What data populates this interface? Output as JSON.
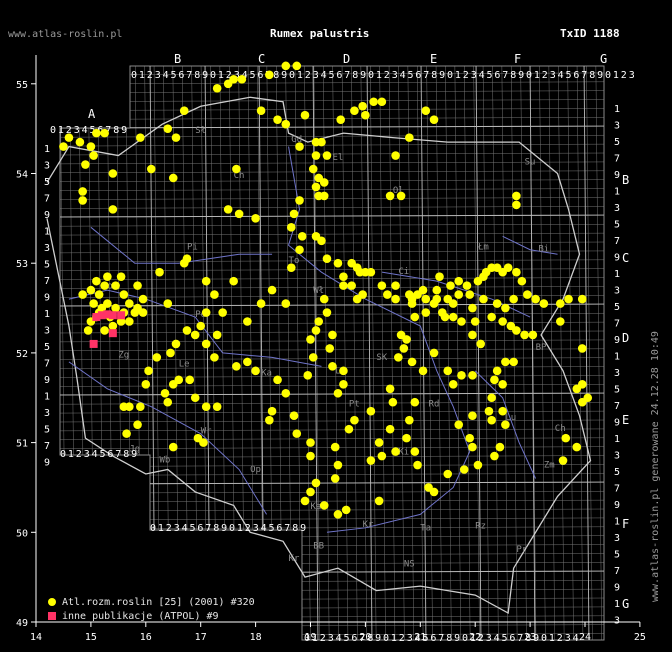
{
  "header": {
    "site": "www.atlas-roslin.pl",
    "title": "Rumex palustris",
    "taxon_id": "TxID 1188"
  },
  "side_note": "www.atlas-roslin.pl generowane 24.12.28 10:49",
  "colors": {
    "background": "#000000",
    "grid": "#8a8a8a",
    "outline": "#cfcfcf",
    "rivers": "#6f74c9",
    "primary_points": "#ffff00",
    "secondary_points": "#ff3366"
  },
  "legend": [
    {
      "symbol": "circle",
      "color": "#ffff00",
      "label": "Atl.rozm.roslin [25] (2001) #320"
    },
    {
      "symbol": "square",
      "color": "#ff3366",
      "label": "inne publikacje (ATPOL) #9"
    }
  ],
  "axes": {
    "x_ticks": [
      14,
      15,
      16,
      17,
      18,
      19,
      20,
      21,
      22,
      23,
      24,
      25
    ],
    "y_ticks": [
      49,
      50,
      51,
      52,
      53,
      54,
      55
    ]
  },
  "grid_letters": {
    "top": [
      "B",
      "C",
      "D",
      "E",
      "F",
      "G"
    ],
    "left_top": "A",
    "right": [
      "B",
      "C",
      "D",
      "E",
      "F",
      "G"
    ]
  },
  "digit_row": "0123456789",
  "cities": [
    {
      "name": "Sł",
      "lon": 16.9,
      "lat": 54.45
    },
    {
      "name": "Gd",
      "lon": 18.65,
      "lat": 54.35
    },
    {
      "name": "El",
      "lon": 19.4,
      "lat": 54.15
    },
    {
      "name": "Ol",
      "lon": 20.5,
      "lat": 53.78
    },
    {
      "name": "Su",
      "lon": 22.9,
      "lat": 54.1
    },
    {
      "name": "Bi",
      "lon": 23.15,
      "lat": 53.13
    },
    {
      "name": "Ch",
      "lon": 17.6,
      "lat": 53.95
    },
    {
      "name": "Pi",
      "lon": 16.75,
      "lat": 53.15
    },
    {
      "name": "To",
      "lon": 18.6,
      "lat": 53.0
    },
    {
      "name": "Wł",
      "lon": 19.05,
      "lat": 52.67
    },
    {
      "name": "Ci",
      "lon": 20.6,
      "lat": 52.88
    },
    {
      "name": "Łm",
      "lon": 22.05,
      "lat": 53.15
    },
    {
      "name": "Go",
      "lon": 15.2,
      "lat": 52.72
    },
    {
      "name": "Po",
      "lon": 16.9,
      "lat": 52.4
    },
    {
      "name": "Zg",
      "lon": 15.5,
      "lat": 51.95
    },
    {
      "name": "Le",
      "lon": 16.6,
      "lat": 51.85
    },
    {
      "name": "Ka",
      "lon": 18.1,
      "lat": 51.75
    },
    {
      "name": "Lo",
      "lon": 19.45,
      "lat": 51.77
    },
    {
      "name": "SK",
      "lon": 20.2,
      "lat": 51.92
    },
    {
      "name": "Pt",
      "lon": 19.7,
      "lat": 51.4
    },
    {
      "name": "Rd",
      "lon": 21.15,
      "lat": 51.4
    },
    {
      "name": "BP",
      "lon": 23.1,
      "lat": 52.03
    },
    {
      "name": "Lu",
      "lon": 22.55,
      "lat": 51.25
    },
    {
      "name": "Wr",
      "lon": 17.0,
      "lat": 51.1
    },
    {
      "name": "Op",
      "lon": 17.9,
      "lat": 50.67
    },
    {
      "name": "Ka",
      "lon": 19.0,
      "lat": 50.26
    },
    {
      "name": "Kr",
      "lon": 19.95,
      "lat": 50.06
    },
    {
      "name": "Ki",
      "lon": 20.6,
      "lat": 50.87
    },
    {
      "name": "Ta",
      "lon": 21.0,
      "lat": 50.02
    },
    {
      "name": "Rz",
      "lon": 22.0,
      "lat": 50.04
    },
    {
      "name": "Pr",
      "lon": 22.75,
      "lat": 49.78
    },
    {
      "name": "Zm",
      "lon": 23.25,
      "lat": 50.72
    },
    {
      "name": "Ch",
      "lon": 23.45,
      "lat": 51.13
    },
    {
      "name": "BB",
      "lon": 19.05,
      "lat": 49.82
    },
    {
      "name": "NS",
      "lon": 20.7,
      "lat": 49.62
    },
    {
      "name": "Wb",
      "lon": 16.25,
      "lat": 50.78
    },
    {
      "name": "Jg",
      "lon": 15.7,
      "lat": 50.9
    },
    {
      "name": "Kr",
      "lon": 18.6,
      "lat": 49.68
    }
  ],
  "primary_points": [
    [
      14.5,
      54.3
    ],
    [
      14.6,
      54.4
    ],
    [
      14.8,
      54.35
    ],
    [
      15.0,
      54.3
    ],
    [
      15.1,
      54.45
    ],
    [
      15.25,
      54.45
    ],
    [
      15.05,
      54.2
    ],
    [
      14.9,
      54.1
    ],
    [
      14.85,
      53.8
    ],
    [
      14.85,
      53.7
    ],
    [
      15.4,
      53.6
    ],
    [
      15.4,
      54.0
    ],
    [
      15.9,
      54.4
    ],
    [
      16.4,
      54.5
    ],
    [
      16.55,
      54.4
    ],
    [
      16.7,
      54.7
    ],
    [
      17.3,
      54.95
    ],
    [
      17.5,
      55.0
    ],
    [
      17.6,
      55.05
    ],
    [
      17.75,
      55.05
    ],
    [
      18.25,
      55.1
    ],
    [
      18.55,
      55.2
    ],
    [
      18.75,
      55.2
    ],
    [
      18.1,
      54.7
    ],
    [
      18.4,
      54.6
    ],
    [
      18.55,
      54.55
    ],
    [
      18.9,
      54.65
    ],
    [
      18.8,
      54.3
    ],
    [
      19.1,
      54.35
    ],
    [
      19.2,
      54.35
    ],
    [
      19.1,
      54.2
    ],
    [
      19.3,
      54.2
    ],
    [
      19.05,
      54.05
    ],
    [
      19.15,
      53.95
    ],
    [
      19.25,
      53.9
    ],
    [
      19.1,
      53.85
    ],
    [
      19.15,
      53.75
    ],
    [
      19.25,
      53.75
    ],
    [
      18.8,
      53.7
    ],
    [
      18.7,
      53.55
    ],
    [
      18.65,
      53.4
    ],
    [
      18.85,
      53.3
    ],
    [
      18.8,
      53.15
    ],
    [
      19.1,
      53.3
    ],
    [
      19.2,
      53.25
    ],
    [
      19.3,
      53.05
    ],
    [
      19.5,
      53.0
    ],
    [
      19.75,
      53.0
    ],
    [
      19.85,
      52.95
    ],
    [
      19.6,
      52.85
    ],
    [
      19.9,
      52.9
    ],
    [
      20.0,
      52.9
    ],
    [
      19.6,
      52.75
    ],
    [
      19.75,
      52.75
    ],
    [
      20.1,
      52.9
    ],
    [
      19.85,
      52.6
    ],
    [
      19.95,
      52.65
    ],
    [
      20.3,
      52.75
    ],
    [
      20.4,
      52.65
    ],
    [
      20.55,
      52.75
    ],
    [
      20.55,
      52.6
    ],
    [
      20.8,
      52.65
    ],
    [
      20.85,
      52.55
    ],
    [
      20.95,
      52.65
    ],
    [
      21.1,
      52.6
    ],
    [
      21.25,
      52.55
    ],
    [
      21.4,
      52.45
    ],
    [
      21.5,
      52.6
    ],
    [
      21.6,
      52.55
    ],
    [
      21.7,
      52.65
    ],
    [
      21.85,
      52.75
    ],
    [
      21.9,
      52.65
    ],
    [
      22.05,
      52.8
    ],
    [
      22.15,
      52.85
    ],
    [
      22.2,
      52.9
    ],
    [
      22.3,
      52.95
    ],
    [
      22.4,
      52.95
    ],
    [
      22.5,
      52.9
    ],
    [
      22.6,
      52.95
    ],
    [
      22.75,
      52.9
    ],
    [
      22.85,
      52.8
    ],
    [
      22.95,
      52.65
    ],
    [
      23.1,
      52.6
    ],
    [
      23.25,
      52.55
    ],
    [
      22.7,
      52.6
    ],
    [
      22.55,
      52.5
    ],
    [
      22.4,
      52.55
    ],
    [
      22.3,
      52.4
    ],
    [
      22.5,
      52.35
    ],
    [
      22.65,
      52.3
    ],
    [
      22.75,
      52.25
    ],
    [
      22.9,
      52.2
    ],
    [
      23.05,
      52.2
    ],
    [
      21.45,
      52.4
    ],
    [
      21.6,
      52.4
    ],
    [
      21.75,
      52.35
    ],
    [
      21.95,
      52.2
    ],
    [
      22.1,
      52.1
    ],
    [
      22.4,
      51.8
    ],
    [
      22.55,
      51.9
    ],
    [
      22.7,
      51.9
    ],
    [
      22.35,
      51.7
    ],
    [
      22.5,
      51.65
    ],
    [
      22.3,
      51.5
    ],
    [
      22.25,
      51.35
    ],
    [
      22.3,
      51.25
    ],
    [
      21.95,
      51.3
    ],
    [
      21.7,
      51.2
    ],
    [
      21.9,
      51.05
    ],
    [
      21.95,
      50.95
    ],
    [
      22.55,
      51.2
    ],
    [
      22.5,
      51.35
    ],
    [
      22.45,
      50.95
    ],
    [
      22.35,
      50.85
    ],
    [
      22.05,
      50.75
    ],
    [
      21.8,
      50.7
    ],
    [
      21.5,
      50.65
    ],
    [
      21.25,
      50.45
    ],
    [
      21.15,
      50.5
    ],
    [
      20.95,
      50.75
    ],
    [
      20.9,
      50.9
    ],
    [
      20.75,
      51.05
    ],
    [
      20.55,
      50.9
    ],
    [
      20.3,
      50.85
    ],
    [
      20.1,
      50.8
    ],
    [
      20.25,
      51.0
    ],
    [
      20.45,
      51.15
    ],
    [
      20.8,
      51.25
    ],
    [
      20.9,
      51.45
    ],
    [
      20.5,
      51.45
    ],
    [
      20.45,
      51.6
    ],
    [
      20.1,
      51.35
    ],
    [
      19.8,
      51.25
    ],
    [
      19.7,
      51.15
    ],
    [
      19.45,
      50.95
    ],
    [
      19.5,
      50.75
    ],
    [
      19.45,
      50.6
    ],
    [
      19.1,
      50.55
    ],
    [
      19.0,
      50.45
    ],
    [
      18.9,
      50.35
    ],
    [
      19.25,
      50.3
    ],
    [
      19.5,
      50.2
    ],
    [
      19.65,
      50.25
    ],
    [
      20.25,
      50.35
    ],
    [
      19.0,
      50.85
    ],
    [
      19.0,
      51.0
    ],
    [
      18.75,
      51.1
    ],
    [
      18.7,
      51.3
    ],
    [
      18.55,
      51.55
    ],
    [
      18.4,
      51.7
    ],
    [
      18.0,
      51.8
    ],
    [
      17.85,
      51.9
    ],
    [
      17.65,
      51.85
    ],
    [
      17.25,
      51.95
    ],
    [
      17.1,
      52.1
    ],
    [
      17.3,
      52.2
    ],
    [
      17.1,
      52.45
    ],
    [
      17.0,
      52.3
    ],
    [
      16.9,
      52.2
    ],
    [
      16.75,
      52.25
    ],
    [
      16.55,
      52.1
    ],
    [
      16.45,
      52.0
    ],
    [
      16.2,
      51.95
    ],
    [
      16.05,
      51.8
    ],
    [
      16.0,
      51.65
    ],
    [
      15.9,
      51.4
    ],
    [
      15.7,
      51.4
    ],
    [
      15.6,
      51.4
    ],
    [
      15.85,
      51.2
    ],
    [
      15.65,
      51.1
    ],
    [
      16.4,
      51.45
    ],
    [
      16.35,
      51.55
    ],
    [
      16.5,
      51.65
    ],
    [
      16.6,
      51.7
    ],
    [
      16.8,
      51.7
    ],
    [
      16.9,
      51.5
    ],
    [
      17.1,
      51.4
    ],
    [
      17.3,
      51.4
    ],
    [
      17.05,
      51.0
    ],
    [
      16.95,
      51.05
    ],
    [
      16.5,
      50.95
    ],
    [
      18.3,
      51.35
    ],
    [
      18.25,
      51.25
    ],
    [
      19.4,
      52.2
    ],
    [
      19.35,
      52.05
    ],
    [
      19.4,
      51.85
    ],
    [
      19.5,
      51.55
    ],
    [
      19.6,
      51.65
    ],
    [
      19.6,
      51.8
    ],
    [
      18.55,
      52.55
    ],
    [
      18.65,
      52.95
    ],
    [
      18.3,
      52.7
    ],
    [
      18.1,
      52.55
    ],
    [
      17.85,
      52.35
    ],
    [
      17.6,
      52.8
    ],
    [
      17.1,
      52.8
    ],
    [
      17.25,
      52.65
    ],
    [
      17.4,
      52.45
    ],
    [
      16.7,
      53.0
    ],
    [
      16.75,
      53.05
    ],
    [
      16.4,
      52.55
    ],
    [
      16.25,
      52.9
    ],
    [
      17.5,
      53.6
    ],
    [
      17.7,
      53.55
    ],
    [
      17.65,
      54.05
    ],
    [
      18.0,
      53.5
    ],
    [
      16.5,
      53.95
    ],
    [
      16.1,
      54.05
    ],
    [
      19.55,
      54.6
    ],
    [
      19.8,
      54.7
    ],
    [
      19.95,
      54.75
    ],
    [
      20.15,
      54.8
    ],
    [
      20.3,
      54.8
    ],
    [
      20.0,
      54.65
    ],
    [
      20.45,
      53.75
    ],
    [
      20.65,
      53.75
    ],
    [
      20.55,
      54.2
    ],
    [
      20.8,
      54.4
    ],
    [
      21.1,
      54.7
    ],
    [
      21.25,
      54.6
    ],
    [
      22.75,
      53.75
    ],
    [
      22.75,
      53.65
    ],
    [
      21.05,
      52.7
    ],
    [
      20.85,
      52.6
    ],
    [
      20.65,
      52.2
    ],
    [
      20.7,
      52.05
    ],
    [
      20.6,
      51.95
    ],
    [
      20.85,
      51.9
    ],
    [
      21.05,
      51.8
    ],
    [
      20.75,
      52.15
    ],
    [
      21.25,
      52.0
    ],
    [
      21.5,
      51.8
    ],
    [
      21.75,
      51.75
    ],
    [
      21.95,
      51.75
    ],
    [
      21.6,
      51.65
    ],
    [
      23.55,
      52.35
    ],
    [
      23.55,
      52.55
    ],
    [
      23.7,
      52.6
    ],
    [
      23.95,
      52.6
    ],
    [
      23.95,
      52.05
    ],
    [
      23.95,
      51.65
    ],
    [
      23.95,
      51.45
    ],
    [
      23.85,
      51.6
    ],
    [
      24.05,
      51.5
    ],
    [
      23.65,
      51.05
    ],
    [
      23.85,
      50.95
    ],
    [
      23.6,
      50.8
    ],
    [
      19.25,
      52.6
    ],
    [
      19.3,
      52.45
    ],
    [
      19.15,
      52.35
    ],
    [
      19.1,
      52.25
    ],
    [
      19.0,
      52.15
    ],
    [
      19.05,
      51.95
    ],
    [
      18.95,
      51.75
    ],
    [
      15.0,
      52.7
    ],
    [
      15.1,
      52.8
    ],
    [
      15.25,
      52.75
    ],
    [
      15.45,
      52.75
    ],
    [
      15.6,
      52.65
    ],
    [
      15.7,
      52.55
    ],
    [
      15.85,
      52.5
    ],
    [
      15.95,
      52.45
    ],
    [
      15.7,
      52.35
    ],
    [
      15.55,
      52.35
    ],
    [
      15.35,
      52.4
    ],
    [
      15.2,
      52.5
    ],
    [
      15.05,
      52.55
    ],
    [
      15.0,
      52.35
    ],
    [
      15.15,
      52.45
    ],
    [
      15.3,
      52.55
    ],
    [
      15.45,
      52.5
    ],
    [
      15.6,
      52.45
    ],
    [
      15.8,
      52.45
    ],
    [
      15.95,
      52.6
    ],
    [
      15.85,
      52.75
    ],
    [
      15.55,
      52.85
    ],
    [
      15.3,
      52.85
    ],
    [
      15.15,
      52.65
    ],
    [
      15.1,
      52.4
    ],
    [
      14.85,
      52.65
    ],
    [
      15.4,
      52.3
    ],
    [
      15.25,
      52.25
    ],
    [
      14.95,
      52.25
    ],
    [
      22.0,
      52.35
    ],
    [
      21.95,
      52.5
    ],
    [
      22.15,
      52.6
    ],
    [
      21.3,
      52.7
    ],
    [
      21.35,
      52.85
    ],
    [
      21.7,
      52.8
    ],
    [
      21.55,
      52.75
    ],
    [
      21.3,
      52.6
    ],
    [
      21.1,
      52.45
    ],
    [
      20.9,
      52.4
    ]
  ],
  "secondary_points": [
    [
      15.05,
      52.1
    ],
    [
      15.1,
      52.4
    ],
    [
      15.2,
      52.42
    ],
    [
      15.3,
      52.43
    ],
    [
      15.4,
      52.42
    ],
    [
      15.55,
      52.42
    ],
    [
      15.4,
      52.22
    ]
  ]
}
